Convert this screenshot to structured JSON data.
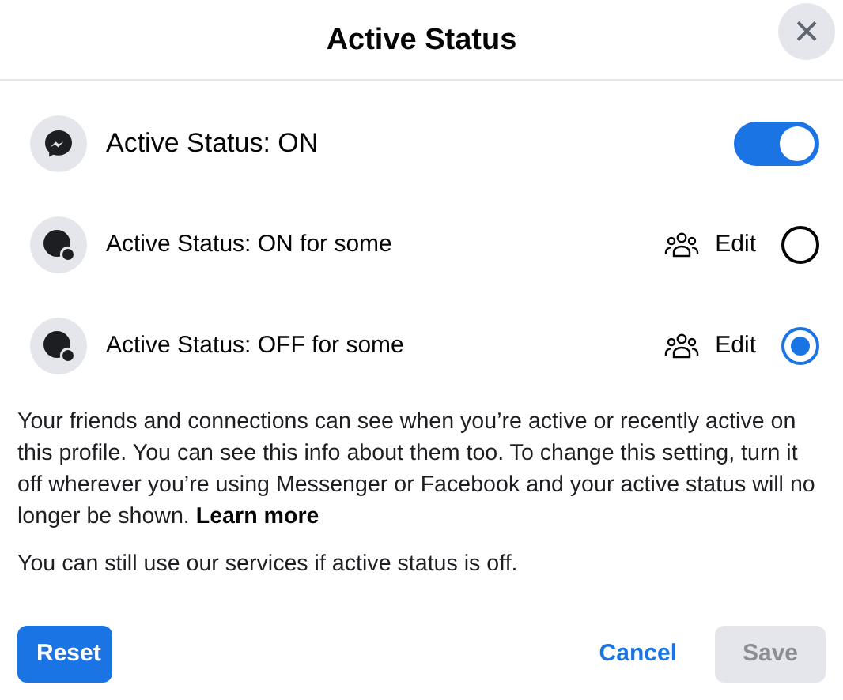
{
  "dialog": {
    "title": "Active Status",
    "close": "×"
  },
  "options": [
    {
      "kind": "toggle",
      "label": "Active Status: ON",
      "on": true
    },
    {
      "kind": "radio",
      "label": "Active Status: ON for some",
      "edit": "Edit",
      "selected": false
    },
    {
      "kind": "radio",
      "label": "Active Status: OFF for some",
      "edit": "Edit",
      "selected": true
    }
  ],
  "description": {
    "text": "Your friends and connections can see when you’re active or recently active on this profile. You can see this info about them too. To change this setting, turn it off wherever you’re using Messenger or Facebook and your active status will no longer be shown.",
    "link": "Learn more"
  },
  "note": "You can still use our services if active status is off.",
  "buttons": [
    {
      "kind": "primary",
      "label": "Reset",
      "disabled": false
    },
    {
      "kind": "link",
      "label": "Cancel",
      "disabled": false
    },
    {
      "kind": "secondary",
      "label": "Save",
      "disabled": true
    }
  ]
}
